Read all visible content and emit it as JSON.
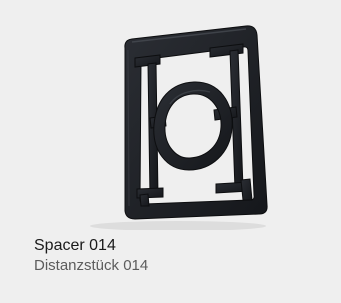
{
  "product": {
    "image_alt": "spacer-part-image",
    "name": "Spacer 014",
    "name_de": "Distanzstück 014",
    "background_color": "#efefef",
    "part_color": "#1f2227"
  }
}
